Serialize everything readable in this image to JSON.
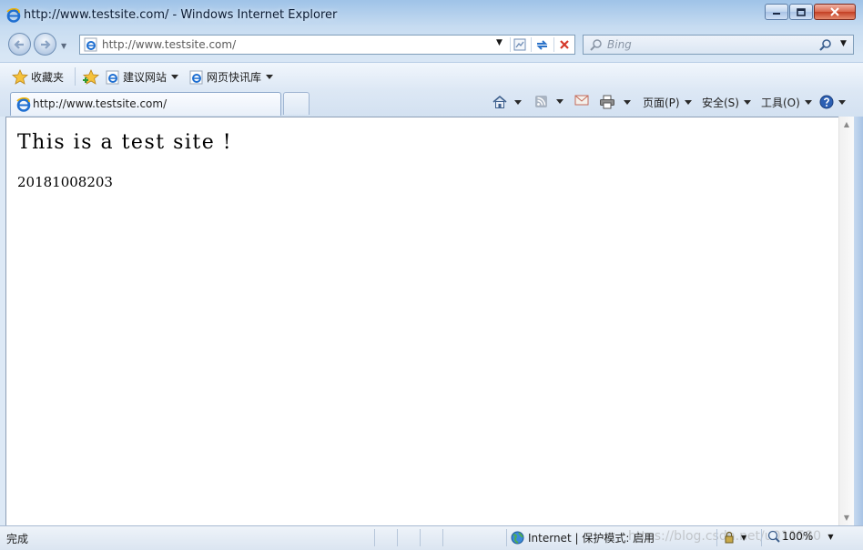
{
  "window": {
    "title": "http://www.testsite.com/ - Windows Internet Explorer"
  },
  "address": {
    "url": "http://www.testsite.com/"
  },
  "search": {
    "placeholder": "Bing"
  },
  "favorites": {
    "label": "收藏夹",
    "items": [
      {
        "label": "建议网站"
      },
      {
        "label": "网页快讯库"
      }
    ]
  },
  "tab": {
    "title": "http://www.testsite.com/"
  },
  "commandbar": {
    "page": "页面(P)",
    "safety": "安全(S)",
    "tools": "工具(O)"
  },
  "content": {
    "heading": "This is a test site !",
    "text": "20181008203"
  },
  "statusbar": {
    "status": "完成",
    "zone": "Internet | 保护模式: 启用",
    "zoom": "100%",
    "watermark": "https://blog.csdn.net/u011580"
  },
  "colors": {
    "ie_blue": "#1f6fd1",
    "ie_gold": "#f2b200",
    "close_red": "#c33f24"
  }
}
